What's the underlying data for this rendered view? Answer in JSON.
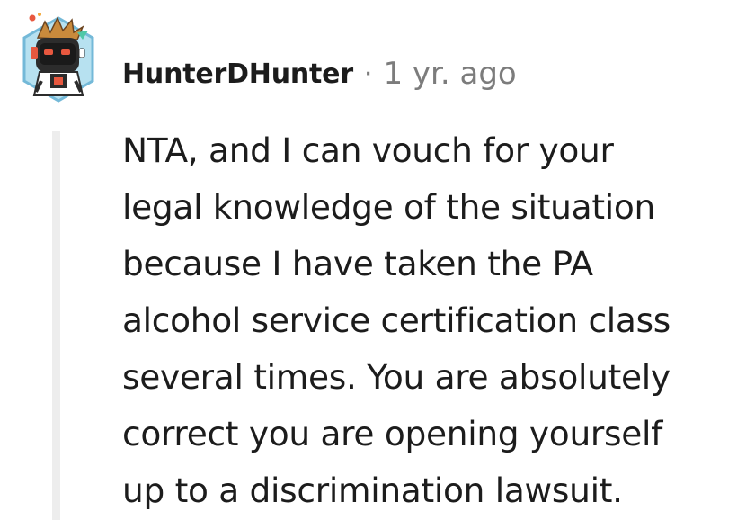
{
  "comment": {
    "author": "HunterDHunter",
    "separator": "·",
    "timestamp": "1 yr. ago",
    "avatar_icon": "robot-avatar-icon",
    "body_lines": [
      "NTA, and I can vouch for your",
      "legal knowledge of the situation",
      "because I have taken the PA",
      "alcohol service certification class",
      "several times. You are absolutely",
      "correct you are opening yourself",
      "up to a discrimination lawsuit."
    ]
  },
  "colors": {
    "text": "#1c1c1c",
    "meta": "#7c7c7c",
    "thread_line": "#ededed",
    "avatar_bg": "#b7e1f0",
    "avatar_border": "#74b9d8"
  }
}
